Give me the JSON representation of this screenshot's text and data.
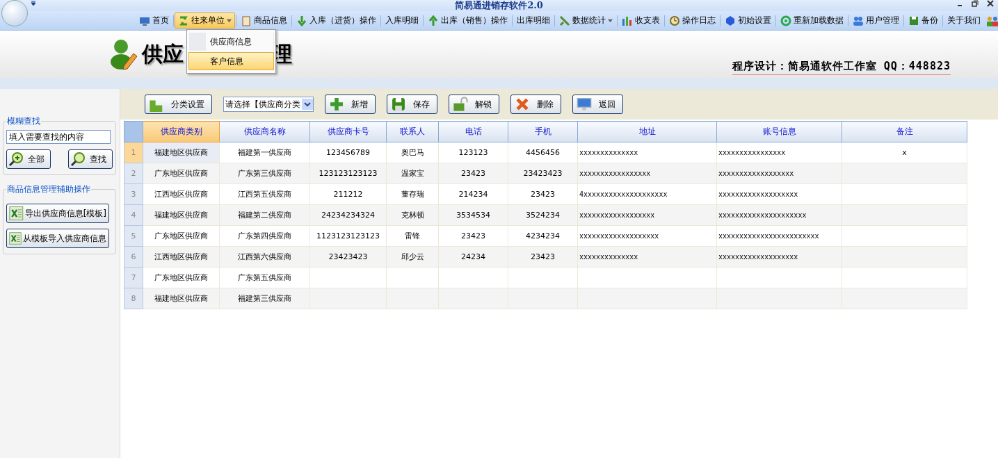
{
  "window": {
    "title": "简易通进销存软件2.0"
  },
  "menu": [
    {
      "label": "首页",
      "selected": false,
      "dropdown": false
    },
    {
      "label": "往来单位",
      "selected": true,
      "dropdown": true
    },
    {
      "label": "商品信息",
      "selected": false,
      "dropdown": false
    },
    {
      "label": "入库（进货）操作",
      "selected": false,
      "dropdown": false
    },
    {
      "label": "入库明细",
      "selected": false,
      "dropdown": false
    },
    {
      "label": "出库（销售）操作",
      "selected": false,
      "dropdown": false
    },
    {
      "label": "出库明细",
      "selected": false,
      "dropdown": false
    },
    {
      "label": "数据统计",
      "selected": false,
      "dropdown": true
    },
    {
      "label": "收支表",
      "selected": false,
      "dropdown": false
    },
    {
      "label": "操作日志",
      "selected": false,
      "dropdown": false
    },
    {
      "label": "初始设置",
      "selected": false,
      "dropdown": false
    },
    {
      "label": "重新加载数据",
      "selected": false,
      "dropdown": false
    },
    {
      "label": "用户管理",
      "selected": false,
      "dropdown": false
    },
    {
      "label": "备份",
      "selected": false,
      "dropdown": false
    },
    {
      "label": "关于我们",
      "selected": false,
      "dropdown": false
    }
  ],
  "dropdown_menu": [
    {
      "label": "供应商信息",
      "selected": false
    },
    {
      "label": "客户信息",
      "selected": true
    }
  ],
  "header": {
    "title_parts": [
      "供应",
      "理"
    ],
    "credit": "程序设计：简易通软件工作室  QQ：448823"
  },
  "search_group": {
    "title": "模糊查找",
    "placeholder": "填入需要查找的内容",
    "buttons": [
      "全部",
      "查找"
    ]
  },
  "aux_group": {
    "title": "商品信息管理辅助操作",
    "buttons": [
      "导出供应商信息[模板]",
      "从模板导入供应商信息"
    ]
  },
  "toolbar": {
    "category_button": "分类设置",
    "category_select": "请选择【供应商分类",
    "buttons": [
      "新增",
      "保存",
      "解锁",
      "删除",
      "返回"
    ]
  },
  "table": {
    "columns": [
      {
        "label": "供应商类别",
        "selected": true
      },
      {
        "label": "供应商名称",
        "selected": false
      },
      {
        "label": "供应商卡号",
        "selected": false
      },
      {
        "label": "联系人",
        "selected": false
      },
      {
        "label": "电话",
        "selected": false
      },
      {
        "label": "手机",
        "selected": false
      },
      {
        "label": "地址",
        "selected": false
      },
      {
        "label": "账号信息",
        "selected": false
      },
      {
        "label": "备注",
        "selected": false
      }
    ],
    "rows": [
      {
        "num": "1",
        "selected": true,
        "cells": [
          "福建地区供应商",
          "福建第一供应商",
          "123456789",
          "奥巴马",
          "123123",
          "4456456",
          "xxxxxxxxxxxxxx",
          "xxxxxxxxxxxxxxxx",
          "x"
        ]
      },
      {
        "num": "2",
        "selected": false,
        "cells": [
          "广东地区供应商",
          "广东第三供应商",
          "123123123123",
          "温家宝",
          "23423",
          "23423423",
          "xxxxxxxxxxxxxxxxx",
          "xxxxxxxxxxxxxxxxxx",
          ""
        ]
      },
      {
        "num": "3",
        "selected": false,
        "cells": [
          "江西地区供应商",
          "江西第五供应商",
          "211212",
          "董存瑞",
          "214234",
          "23423",
          "4xxxxxxxxxxxxxxxxxxxx",
          "xxxxxxxxxxxxxxxxxxx",
          ""
        ]
      },
      {
        "num": "4",
        "selected": false,
        "cells": [
          "福建地区供应商",
          "福建第二供应商",
          "24234234324",
          "克林顿",
          "3534534",
          "3524234",
          "xxxxxxxxxxxxxxxxxx",
          "xxxxxxxxxxxxxxxxxxxxx",
          ""
        ]
      },
      {
        "num": "5",
        "selected": false,
        "cells": [
          "广东地区供应商",
          "广东第四供应商",
          "1123123123123",
          "雷锋",
          "23423",
          "4234234",
          "xxxxxxxxxxxxxxxxxxx",
          "xxxxxxxxxxxxxxxxxxxxxxxx",
          ""
        ]
      },
      {
        "num": "6",
        "selected": false,
        "cells": [
          "江西地区供应商",
          "江西第六供应商",
          "23423423",
          "邱少云",
          "24234",
          "23423",
          "xxxxxxxxxxxxxx",
          "xxxxxxxxxxxxxxxxxxx",
          ""
        ]
      },
      {
        "num": "7",
        "selected": false,
        "cells": [
          "广东地区供应商",
          "广东第五供应商",
          "",
          "",
          "",
          "",
          "",
          "",
          ""
        ]
      },
      {
        "num": "8",
        "selected": false,
        "cells": [
          "福建地区供应商",
          "福建第三供应商",
          "",
          "",
          "",
          "",
          "",
          "",
          ""
        ]
      }
    ]
  }
}
